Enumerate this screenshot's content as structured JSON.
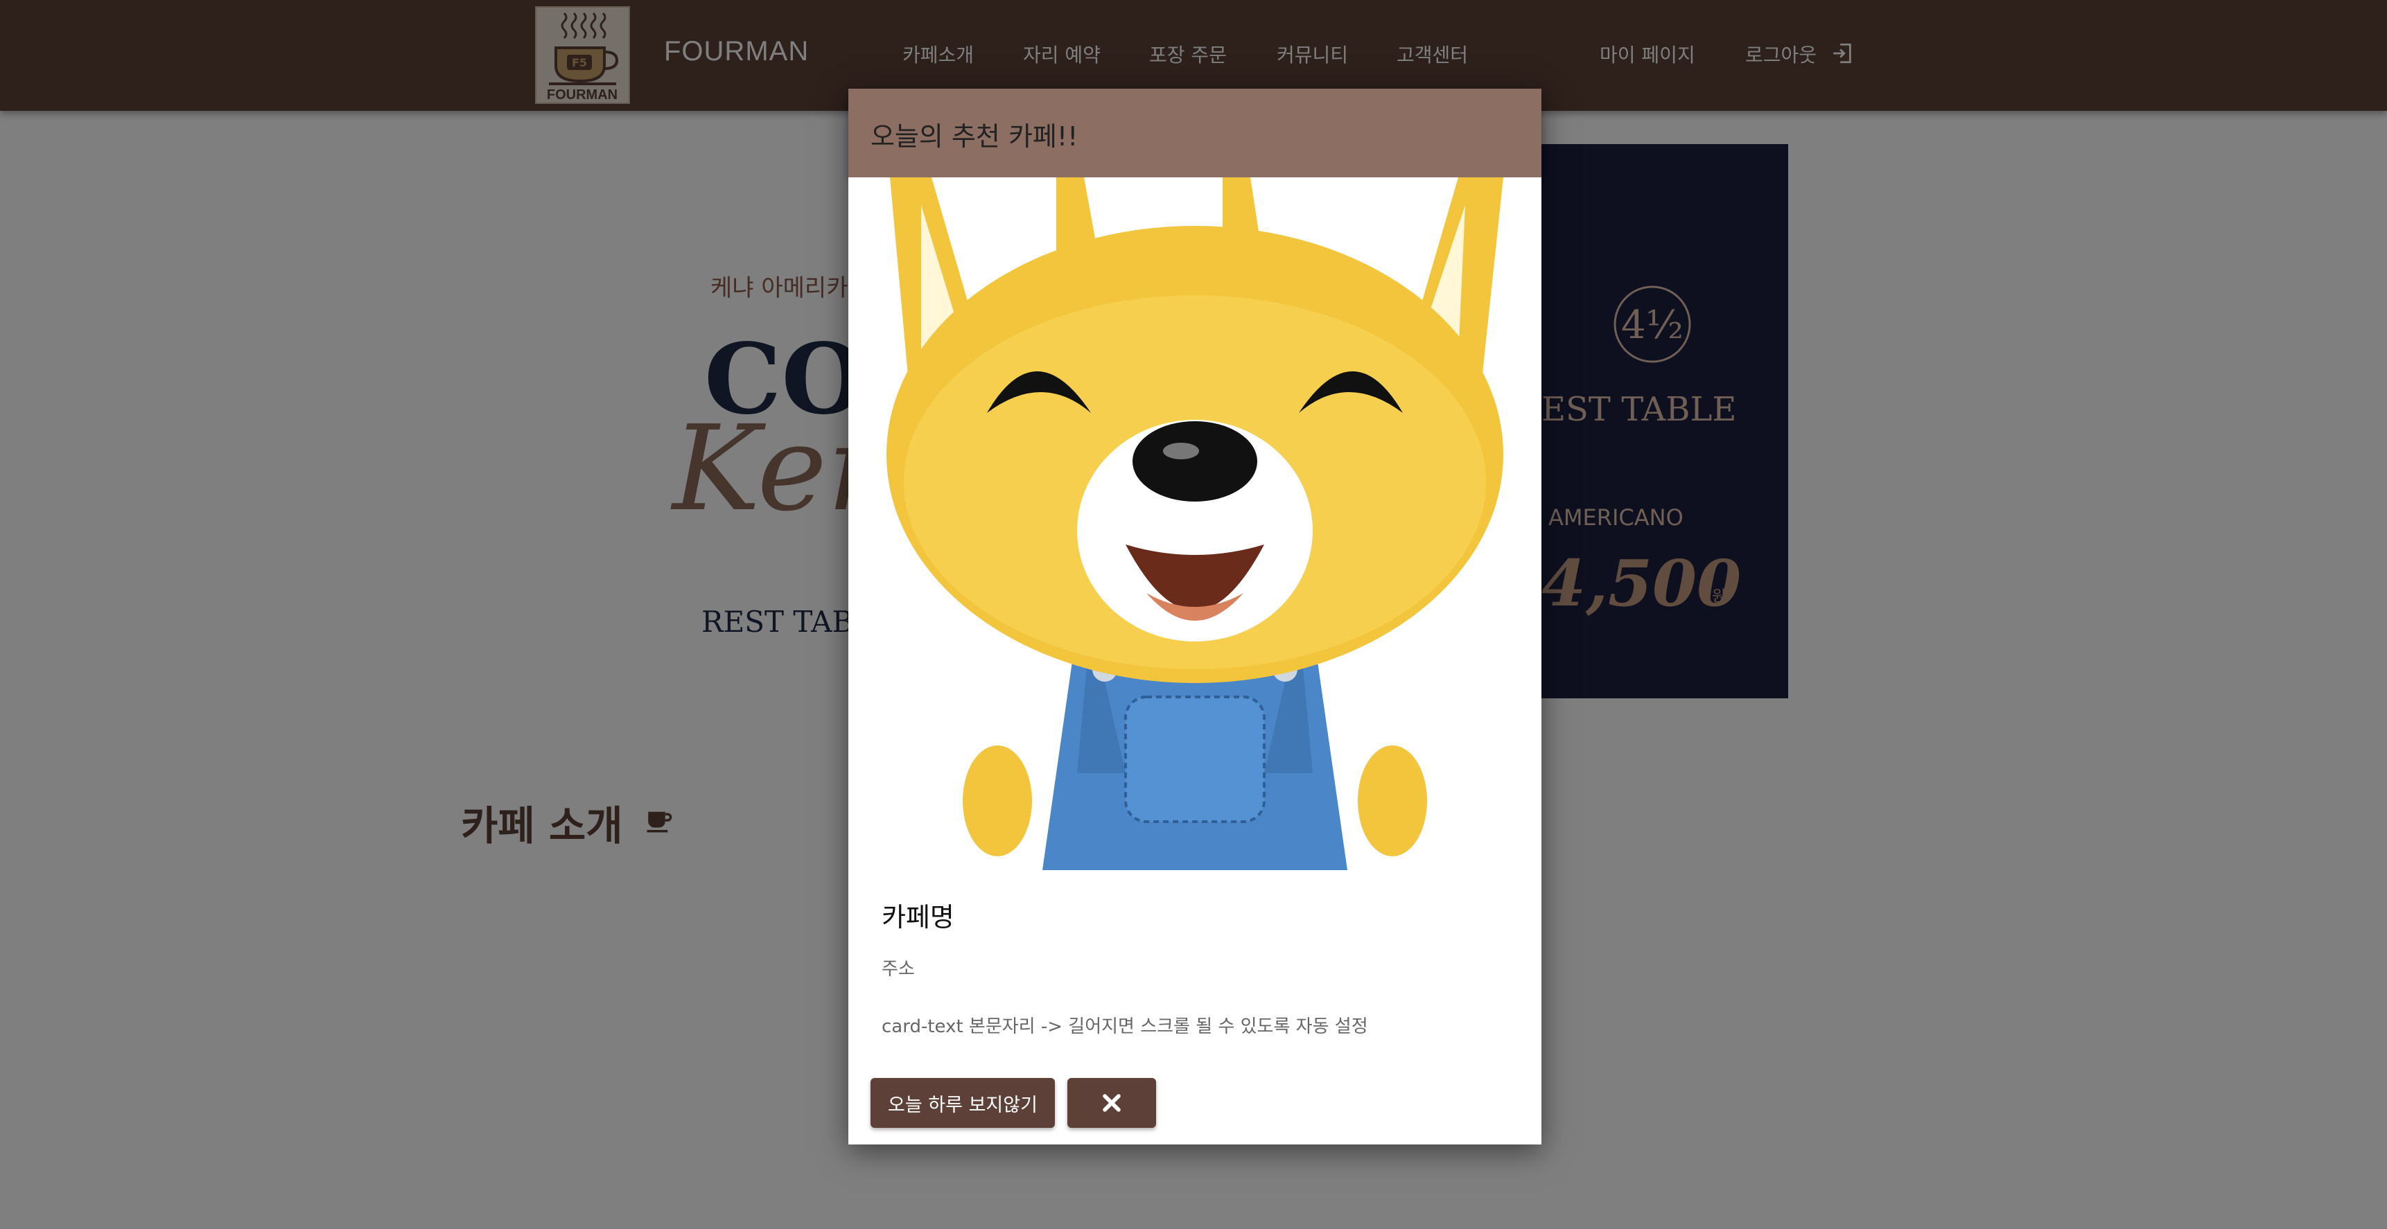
{
  "header": {
    "brand": "FOURMAN",
    "logo_text": "FOURMAN",
    "nav": [
      "카페소개",
      "자리 예약",
      "포장 주문",
      "커뮤니티",
      "고객센터"
    ],
    "right": [
      "마이 페이지",
      "로그아웃"
    ]
  },
  "background": {
    "banner_left": {
      "small_text": "케냐 아메리카",
      "big_text": "COU",
      "script_text": "Ken",
      "rest_text": "REST TABL"
    },
    "banner_right": {
      "logo": "4½",
      "table_text": "EST TABLE",
      "americano": "AMERICANO",
      "price": "4,500",
      "won": "원"
    },
    "section_title": "카페 소개"
  },
  "modal": {
    "title": "오늘의 추천 카페!!",
    "card_title": "카페명",
    "card_subtitle": "주소",
    "card_text": "card-text 본문자리 -> 길어지면 스크롤 될 수 있도록 자동 설정",
    "hide_today_label": "오늘 하루 보지않기",
    "close_icon": "close-x-icon"
  },
  "colors": {
    "header_bg": "#5d4037",
    "modal_header_bg": "#8d6e63",
    "button_bg": "#5d4037",
    "overlay": "rgba(0,0,0,0.5)"
  }
}
